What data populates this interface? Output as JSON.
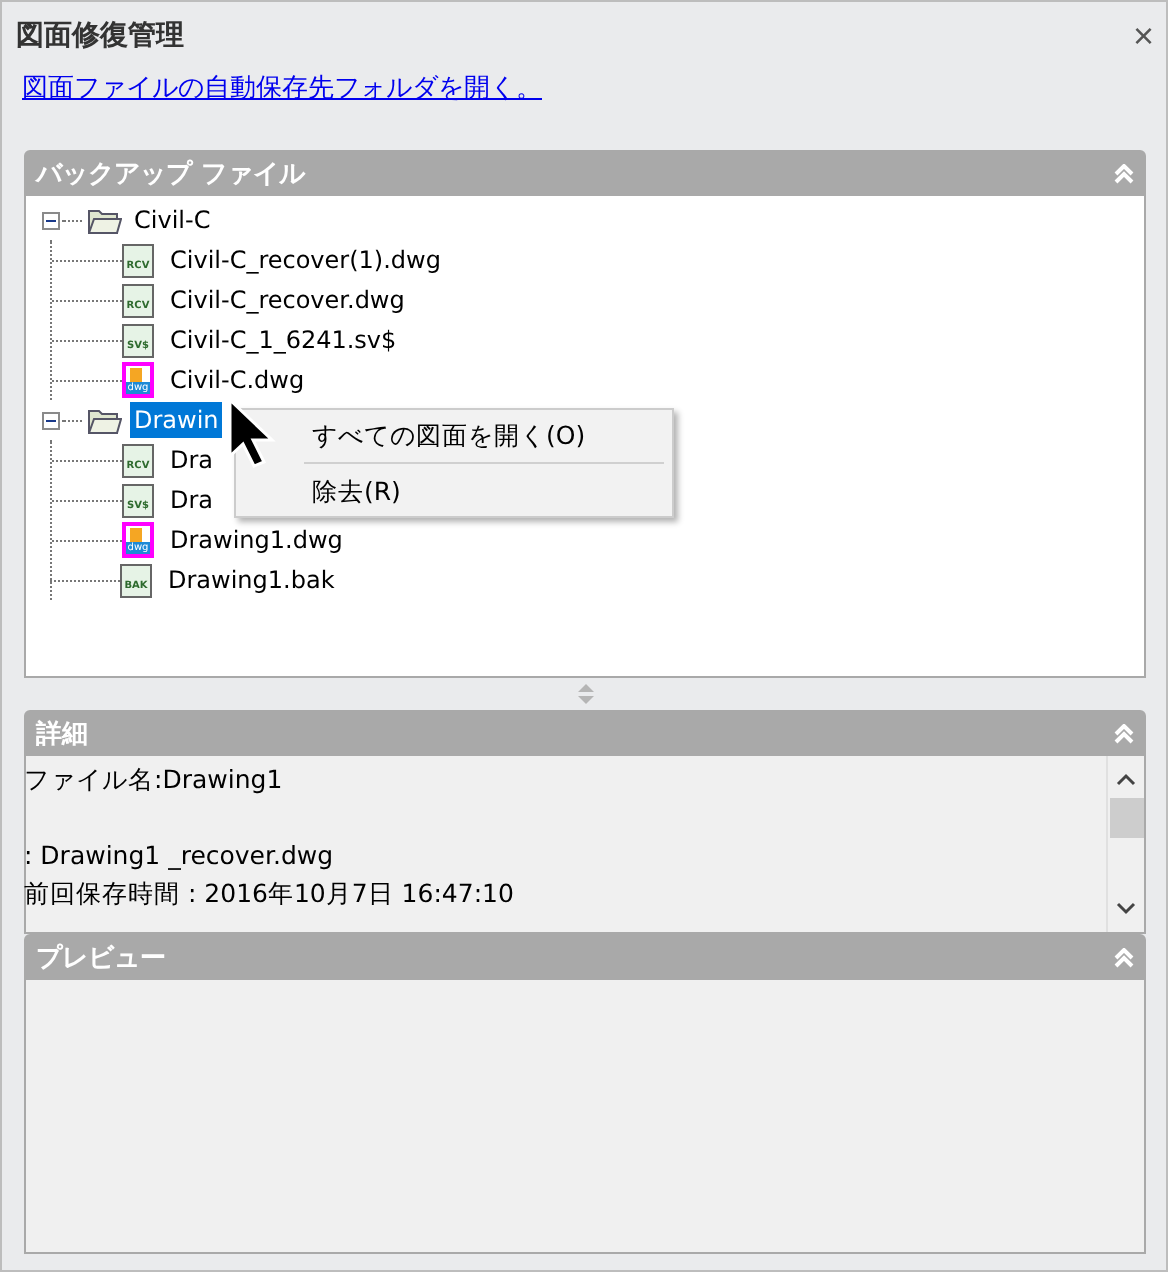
{
  "window": {
    "title": "図面修復管理",
    "close": "×"
  },
  "link": "図面ファイルの自動保存先フォルダを開く。",
  "backup": {
    "title": "バックアップ ファイル",
    "expanded": true,
    "tree": [
      {
        "label": "Civil-C",
        "expanded": true,
        "selected": false,
        "children": [
          {
            "label": "Civil-C_recover(1).dwg",
            "kind": "rcv",
            "tag": "RCV",
            "selected": false
          },
          {
            "label": "Civil-C_recover.dwg",
            "kind": "rcv",
            "tag": "RCV",
            "selected": false
          },
          {
            "label": "Civil-C_1_6241.sv$",
            "kind": "svs",
            "tag": "SV$",
            "selected": false
          },
          {
            "label": "Civil-C.dwg",
            "kind": "dwg",
            "tag": "dwg",
            "selected": false
          }
        ]
      },
      {
        "label": "Drawin",
        "expanded": true,
        "selected": true,
        "children": [
          {
            "label": "Dra",
            "kind": "rcv",
            "tag": "RCV",
            "selected": false
          },
          {
            "label": "Dra",
            "kind": "svs",
            "tag": "SV$",
            "selected": false
          },
          {
            "label": "Drawing1.dwg",
            "kind": "dwg",
            "tag": "dwg",
            "selected": false
          },
          {
            "label": "Drawing1.bak",
            "kind": "bak",
            "tag": "BAK",
            "selected": false
          }
        ]
      }
    ],
    "context_menu": [
      {
        "label": "すべての図面を開く(O)"
      },
      {
        "label": "除去(R)"
      }
    ]
  },
  "details": {
    "title": "詳細",
    "expanded": true,
    "lines": [
      "ファイル名:Drawing1",
      ": Drawing1 _recover.dwg",
      "前回保存時間 : 2016年10月7日  16:47:10"
    ]
  },
  "preview": {
    "title": "プレビュー",
    "expanded": true
  }
}
